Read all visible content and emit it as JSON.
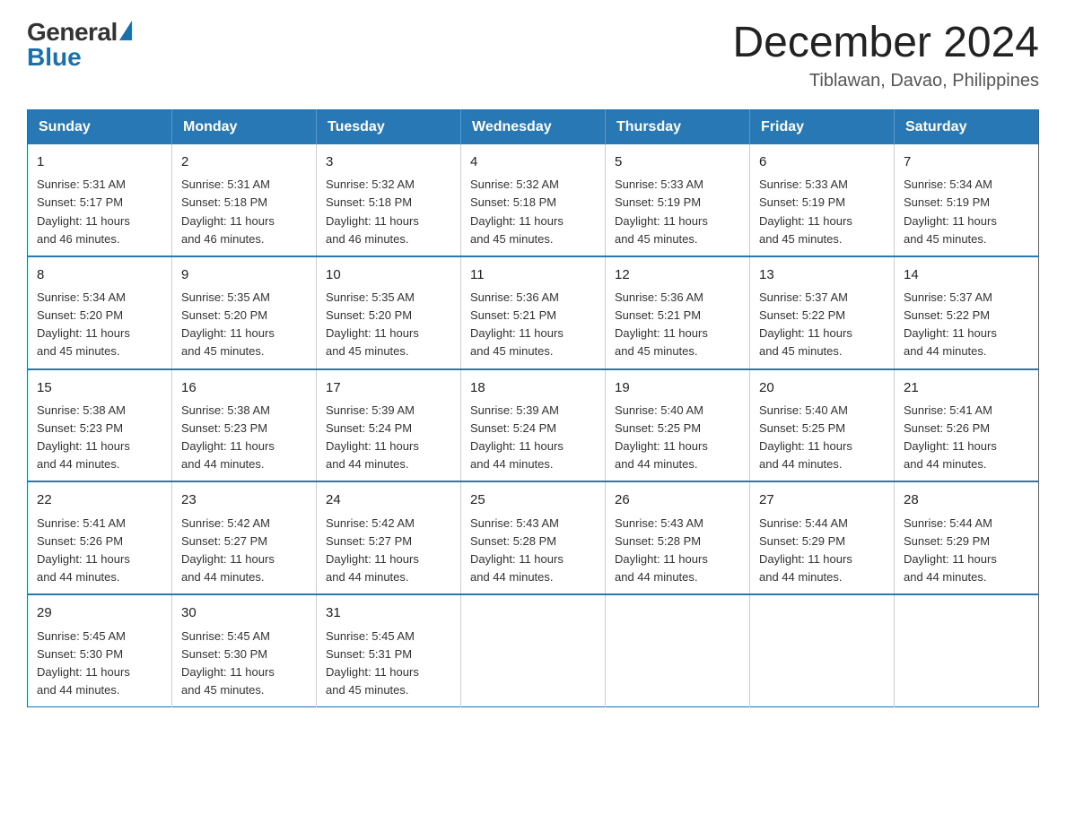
{
  "logo": {
    "general": "General",
    "blue": "Blue"
  },
  "title": "December 2024",
  "location": "Tiblawan, Davao, Philippines",
  "days_of_week": [
    "Sunday",
    "Monday",
    "Tuesday",
    "Wednesday",
    "Thursday",
    "Friday",
    "Saturday"
  ],
  "weeks": [
    [
      {
        "day": "1",
        "sunrise": "5:31 AM",
        "sunset": "5:17 PM",
        "daylight": "11 hours and 46 minutes."
      },
      {
        "day": "2",
        "sunrise": "5:31 AM",
        "sunset": "5:18 PM",
        "daylight": "11 hours and 46 minutes."
      },
      {
        "day": "3",
        "sunrise": "5:32 AM",
        "sunset": "5:18 PM",
        "daylight": "11 hours and 46 minutes."
      },
      {
        "day": "4",
        "sunrise": "5:32 AM",
        "sunset": "5:18 PM",
        "daylight": "11 hours and 45 minutes."
      },
      {
        "day": "5",
        "sunrise": "5:33 AM",
        "sunset": "5:19 PM",
        "daylight": "11 hours and 45 minutes."
      },
      {
        "day": "6",
        "sunrise": "5:33 AM",
        "sunset": "5:19 PM",
        "daylight": "11 hours and 45 minutes."
      },
      {
        "day": "7",
        "sunrise": "5:34 AM",
        "sunset": "5:19 PM",
        "daylight": "11 hours and 45 minutes."
      }
    ],
    [
      {
        "day": "8",
        "sunrise": "5:34 AM",
        "sunset": "5:20 PM",
        "daylight": "11 hours and 45 minutes."
      },
      {
        "day": "9",
        "sunrise": "5:35 AM",
        "sunset": "5:20 PM",
        "daylight": "11 hours and 45 minutes."
      },
      {
        "day": "10",
        "sunrise": "5:35 AM",
        "sunset": "5:20 PM",
        "daylight": "11 hours and 45 minutes."
      },
      {
        "day": "11",
        "sunrise": "5:36 AM",
        "sunset": "5:21 PM",
        "daylight": "11 hours and 45 minutes."
      },
      {
        "day": "12",
        "sunrise": "5:36 AM",
        "sunset": "5:21 PM",
        "daylight": "11 hours and 45 minutes."
      },
      {
        "day": "13",
        "sunrise": "5:37 AM",
        "sunset": "5:22 PM",
        "daylight": "11 hours and 45 minutes."
      },
      {
        "day": "14",
        "sunrise": "5:37 AM",
        "sunset": "5:22 PM",
        "daylight": "11 hours and 44 minutes."
      }
    ],
    [
      {
        "day": "15",
        "sunrise": "5:38 AM",
        "sunset": "5:23 PM",
        "daylight": "11 hours and 44 minutes."
      },
      {
        "day": "16",
        "sunrise": "5:38 AM",
        "sunset": "5:23 PM",
        "daylight": "11 hours and 44 minutes."
      },
      {
        "day": "17",
        "sunrise": "5:39 AM",
        "sunset": "5:24 PM",
        "daylight": "11 hours and 44 minutes."
      },
      {
        "day": "18",
        "sunrise": "5:39 AM",
        "sunset": "5:24 PM",
        "daylight": "11 hours and 44 minutes."
      },
      {
        "day": "19",
        "sunrise": "5:40 AM",
        "sunset": "5:25 PM",
        "daylight": "11 hours and 44 minutes."
      },
      {
        "day": "20",
        "sunrise": "5:40 AM",
        "sunset": "5:25 PM",
        "daylight": "11 hours and 44 minutes."
      },
      {
        "day": "21",
        "sunrise": "5:41 AM",
        "sunset": "5:26 PM",
        "daylight": "11 hours and 44 minutes."
      }
    ],
    [
      {
        "day": "22",
        "sunrise": "5:41 AM",
        "sunset": "5:26 PM",
        "daylight": "11 hours and 44 minutes."
      },
      {
        "day": "23",
        "sunrise": "5:42 AM",
        "sunset": "5:27 PM",
        "daylight": "11 hours and 44 minutes."
      },
      {
        "day": "24",
        "sunrise": "5:42 AM",
        "sunset": "5:27 PM",
        "daylight": "11 hours and 44 minutes."
      },
      {
        "day": "25",
        "sunrise": "5:43 AM",
        "sunset": "5:28 PM",
        "daylight": "11 hours and 44 minutes."
      },
      {
        "day": "26",
        "sunrise": "5:43 AM",
        "sunset": "5:28 PM",
        "daylight": "11 hours and 44 minutes."
      },
      {
        "day": "27",
        "sunrise": "5:44 AM",
        "sunset": "5:29 PM",
        "daylight": "11 hours and 44 minutes."
      },
      {
        "day": "28",
        "sunrise": "5:44 AM",
        "sunset": "5:29 PM",
        "daylight": "11 hours and 44 minutes."
      }
    ],
    [
      {
        "day": "29",
        "sunrise": "5:45 AM",
        "sunset": "5:30 PM",
        "daylight": "11 hours and 44 minutes."
      },
      {
        "day": "30",
        "sunrise": "5:45 AM",
        "sunset": "5:30 PM",
        "daylight": "11 hours and 45 minutes."
      },
      {
        "day": "31",
        "sunrise": "5:45 AM",
        "sunset": "5:31 PM",
        "daylight": "11 hours and 45 minutes."
      },
      null,
      null,
      null,
      null
    ]
  ],
  "labels": {
    "sunrise": "Sunrise:",
    "sunset": "Sunset:",
    "daylight": "Daylight:"
  }
}
